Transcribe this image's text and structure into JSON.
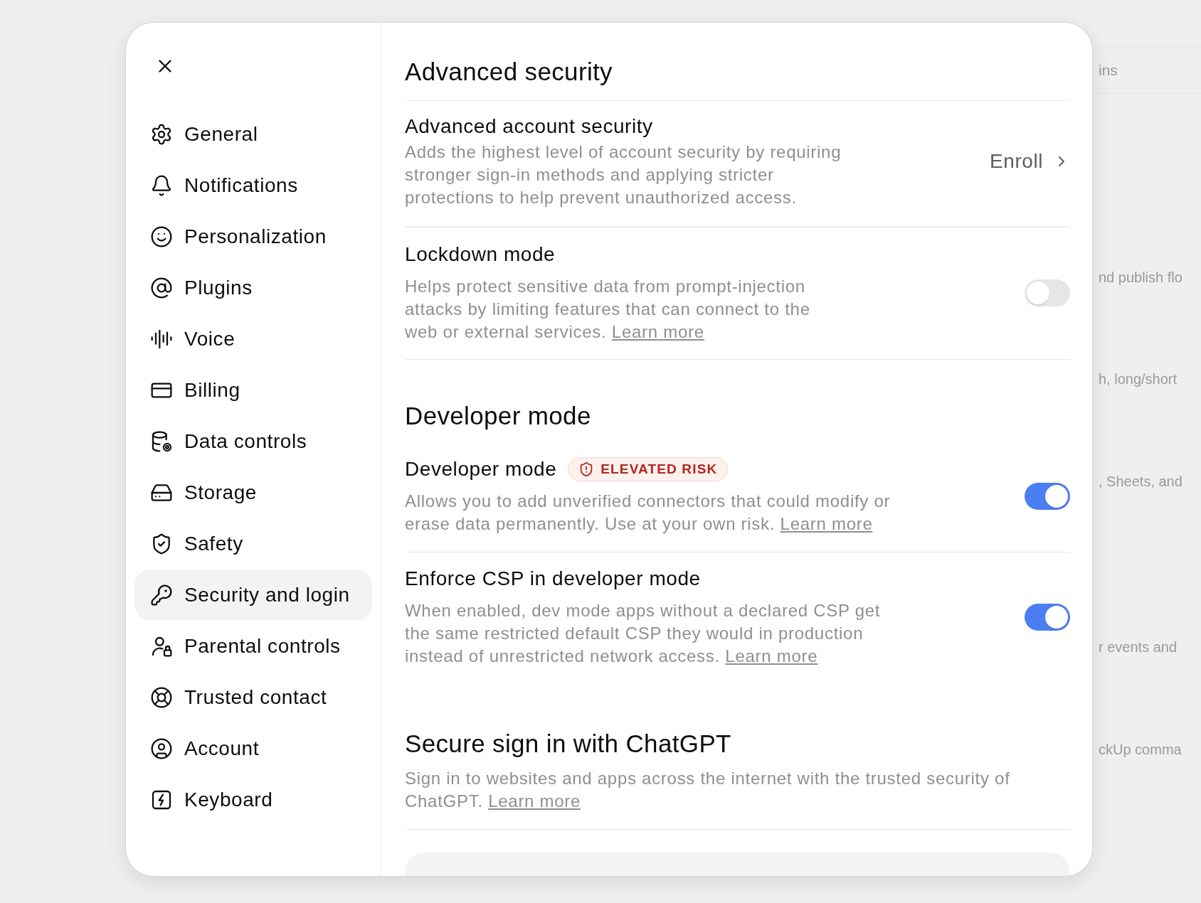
{
  "dialog": {
    "sidebar": {
      "items": [
        {
          "label": "General",
          "selected": false
        },
        {
          "label": "Notifications",
          "selected": false
        },
        {
          "label": "Personalization",
          "selected": false
        },
        {
          "label": "Plugins",
          "selected": false
        },
        {
          "label": "Voice",
          "selected": false
        },
        {
          "label": "Billing",
          "selected": false
        },
        {
          "label": "Data controls",
          "selected": false
        },
        {
          "label": "Storage",
          "selected": false
        },
        {
          "label": "Safety",
          "selected": false
        },
        {
          "label": "Security and login",
          "selected": true
        },
        {
          "label": "Parental controls",
          "selected": false
        },
        {
          "label": "Trusted contact",
          "selected": false
        },
        {
          "label": "Account",
          "selected": false
        },
        {
          "label": "Keyboard",
          "selected": false
        }
      ]
    },
    "content": {
      "sections": [
        {
          "heading": "Advanced security",
          "rows": [
            {
              "kind": "link",
              "title": "Advanced account security",
              "description": "Adds the highest level of account security by requiring stronger sign-in methods and applying stricter protections to help prevent unauthorized access.",
              "action": "Enroll"
            },
            {
              "kind": "toggle",
              "title": "Lockdown mode",
              "description": "Helps protect sensitive data from prompt-injection attacks by limiting features that can connect to the web or external services.",
              "link": "Learn more",
              "on": false
            }
          ]
        },
        {
          "heading": "Developer mode",
          "rows": [
            {
              "kind": "toggle",
              "title": "Developer mode",
              "badge": "ELEVATED RISK",
              "description": "Allows you to add unverified connectors that could modify or erase data permanently. Use at your own risk.",
              "link": "Learn more",
              "on": true
            },
            {
              "kind": "toggle",
              "title": "Enforce CSP in developer mode",
              "description": "When enabled, dev mode apps without a declared CSP get the same restricted default CSP they would in production instead of unrestricted network access.",
              "link": "Learn more",
              "on": true
            }
          ]
        },
        {
          "heading": "Secure sign in with ChatGPT",
          "description": "Sign in to websites and apps across the internet with the trusted security of ChatGPT.",
          "link": "Learn more"
        }
      ]
    }
  },
  "background": {
    "header": "ins",
    "fragments": [
      "nd publish flo",
      "h, long/short",
      ", Sheets, and",
      "r events and",
      "ckUp comma"
    ]
  }
}
